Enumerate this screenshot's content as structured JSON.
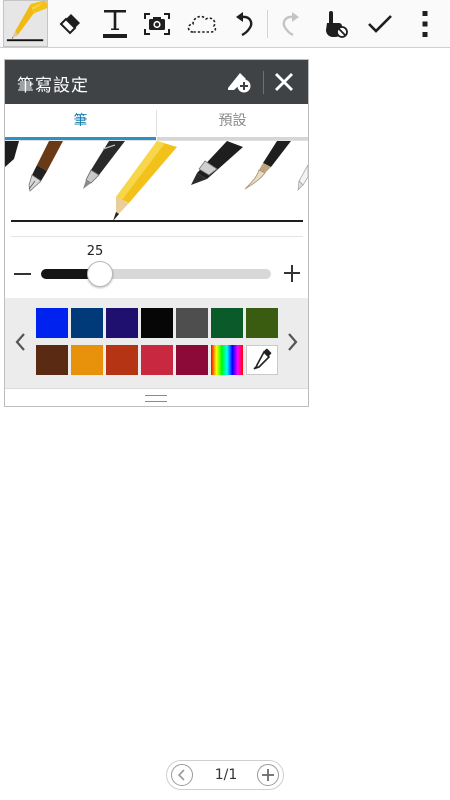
{
  "toolbar": {
    "tools": [
      {
        "name": "pen-tool",
        "icon": "pencil-icon",
        "active": true
      },
      {
        "name": "eraser-tool",
        "icon": "eraser-icon"
      },
      {
        "name": "text-tool",
        "icon": "text-icon",
        "glyph": "T"
      },
      {
        "name": "image-tool",
        "icon": "camera-icon"
      },
      {
        "name": "selection-tool",
        "icon": "lasso-icon"
      },
      {
        "name": "undo",
        "icon": "undo-icon"
      },
      {
        "name": "redo",
        "icon": "redo-icon",
        "disabled": true
      },
      {
        "name": "hand-mode",
        "icon": "hand-no-touch-icon"
      },
      {
        "name": "done",
        "icon": "check-icon"
      },
      {
        "name": "more",
        "icon": "more-vert-icon"
      }
    ]
  },
  "panel": {
    "title": "筆寫設定",
    "preset_add_icon": "pen-add-icon",
    "close_icon": "close-icon",
    "tabs": [
      {
        "label": "筆",
        "selected": true
      },
      {
        "label": "預設",
        "selected": false
      }
    ],
    "pens": [
      "brush-pen",
      "fountain-pen",
      "ballpoint-pen",
      "pencil",
      "marker",
      "calligraphy-brush",
      "correction-pen"
    ],
    "selected_pen": "pencil",
    "size": {
      "value": "25",
      "fraction": 0.25
    },
    "colors": {
      "row1": [
        "#0022ee",
        "#003a78",
        "#1f0f6e",
        "#060606",
        "#4e4e4e",
        "#0a5a2a",
        "#3a5c10"
      ],
      "row2": [
        "#5a2a12",
        "#e8920c",
        "#b43414",
        "#c82840",
        "#8c0a38",
        "rainbow",
        "picker"
      ],
      "prev_icon": "chevron-left-icon",
      "next_icon": "chevron-right-icon"
    }
  },
  "pager": {
    "text": "1/1",
    "prev_icon": "chevron-left-icon",
    "add_icon": "plus-icon"
  }
}
